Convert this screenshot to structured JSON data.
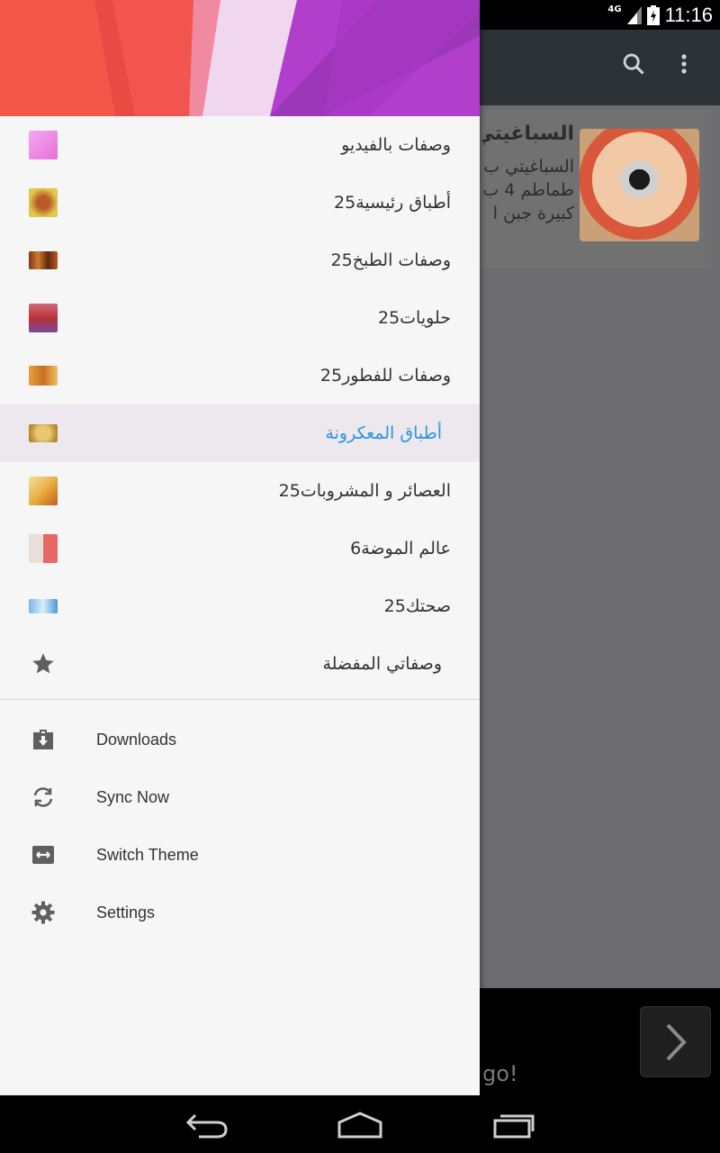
{
  "status_bar": {
    "network": "4G",
    "time": "11:16"
  },
  "background": {
    "card_title": "السباغيتي",
    "card_lines": [
      "السباغيتي ب",
      "طماطم 4 ب",
      "كبيرة جبن ا"
    ],
    "bottom_text": "go!"
  },
  "drawer": {
    "categories": [
      {
        "label": "وصفات بالفيديو",
        "count": ""
      },
      {
        "label": "أطباق رئيسية",
        "count": "25"
      },
      {
        "label": "وصفات الطبخ",
        "count": "25"
      },
      {
        "label": "حلويات",
        "count": "25"
      },
      {
        "label": "وصفات للفطور",
        "count": "25"
      },
      {
        "label": "أطباق المعكرونة",
        "count": "",
        "selected": true
      },
      {
        "label": "العصائر و المشروبات",
        "count": "25"
      },
      {
        "label": "عالم الموضة",
        "count": "6"
      },
      {
        "label": "صحتك",
        "count": "25"
      }
    ],
    "favorites": {
      "label": "وصفاتي المفضلة",
      "icon": "star-icon"
    },
    "menu": [
      {
        "label": "Downloads",
        "icon": "download-icon"
      },
      {
        "label": "Sync Now",
        "icon": "sync-icon"
      },
      {
        "label": "Switch Theme",
        "icon": "switch-theme-icon"
      },
      {
        "label": "Settings",
        "icon": "gear-icon"
      }
    ],
    "accent_color": "#2a95e0"
  }
}
